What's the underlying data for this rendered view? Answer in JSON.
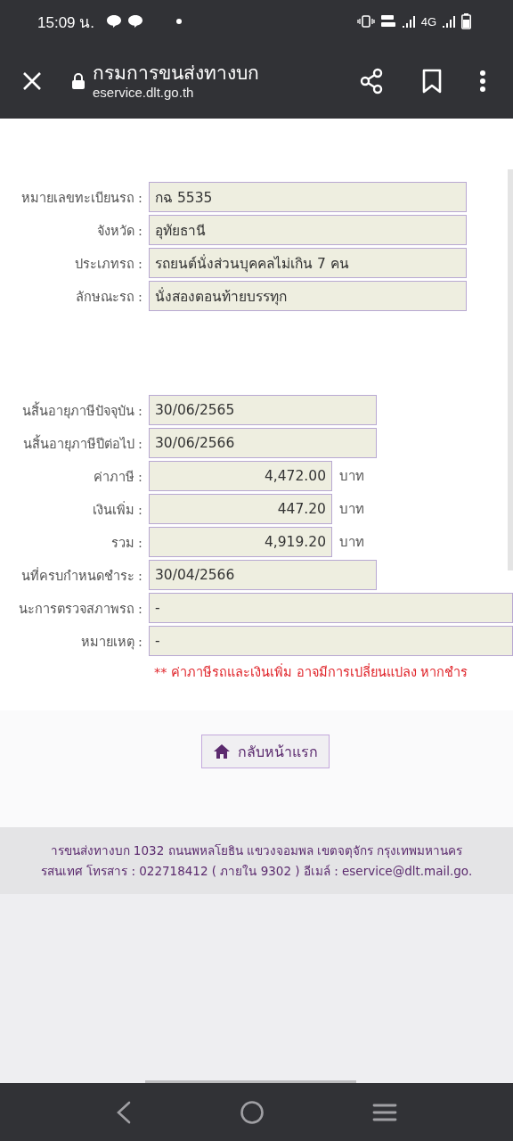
{
  "status_bar": {
    "time": "15:09 น.",
    "network": "4G"
  },
  "toolbar": {
    "title": "กรมการขนส่งทางบก",
    "url": "eservice.dlt.go.th"
  },
  "vehicle_fields": [
    {
      "label": "หมายเลขทะเบียนรถ :",
      "value": "กฉ 5535",
      "kind": "text"
    },
    {
      "label": "จังหวัด :",
      "value": "อุทัยธานี",
      "kind": "text"
    },
    {
      "label": "ประเภทรถ :",
      "value": "รถยนต์นั่งส่วนบุคคลไม่เกิน 7 คน",
      "kind": "text"
    },
    {
      "label": "ลักษณะรถ :",
      "value": "นั่งสองตอนท้ายบรรทุก",
      "kind": "text"
    }
  ],
  "tax_fields": [
    {
      "label": "นสิ้นอายุภาษีปัจจุบัน :",
      "value": "30/06/2565",
      "kind": "date"
    },
    {
      "label": "นสิ้นอายุภาษีปีต่อไป :",
      "value": "30/06/2566",
      "kind": "date"
    },
    {
      "label": "ค่าภาษี :",
      "value": "4,472.00",
      "kind": "money",
      "unit": "บาท"
    },
    {
      "label": "เงินเพิ่ม :",
      "value": "447.20",
      "kind": "money",
      "unit": "บาท"
    },
    {
      "label": "รวม :",
      "value": "4,919.20",
      "kind": "money",
      "unit": "บาท"
    },
    {
      "label": "นที่ครบกำหนดชำระ :",
      "value": "30/04/2566",
      "kind": "date"
    },
    {
      "label": "นะการตรวจสภาพรถ :",
      "value": "-",
      "kind": "wide"
    },
    {
      "label": "หมายเหตุ :",
      "value": "-",
      "kind": "wide"
    }
  ],
  "note": "** ค่าภาษีรถและเงินเพิ่ม อาจมีการเปลี่ยนแปลง หากชำร",
  "home_button": "กลับหน้าแรก",
  "footer": [
    "ารขนส่งทางบก 1032 ถนนพหลโยธิน แขวงจอมพล เขตจตุจักร กรุงเทพมหานคร",
    "รสนเทศ โทรสาร : 022718412 ( ภายใน 9302 ) อีเมล์ : eservice@dlt.mail.go."
  ]
}
